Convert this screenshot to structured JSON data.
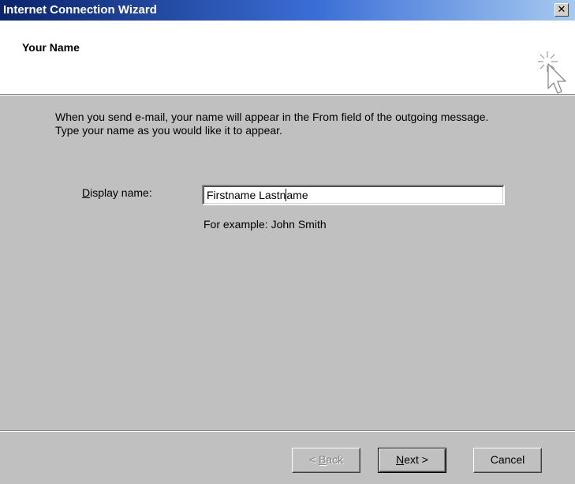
{
  "window": {
    "title": "Internet Connection Wizard",
    "close_icon": "close-x-icon",
    "close_glyph": "✕"
  },
  "header": {
    "page_title": "Your Name",
    "icon": "wizard-cursor-icon"
  },
  "intro": {
    "line1": "When you send e-mail, your name will appear in the From field of the outgoing message.",
    "line2": "Type your name as you would like it to appear."
  },
  "display_name": {
    "label_hotkey": "D",
    "label_rest": "isplay name:",
    "value_before_caret": "Firstname Lastn",
    "value_after_caret": "ame",
    "example": "For example: John Smith"
  },
  "buttons": {
    "back_prefix": "< ",
    "back_hotkey": "B",
    "back_rest": "ack",
    "back_enabled": false,
    "next_hotkey": "N",
    "next_rest": "ext >",
    "cancel": "Cancel"
  },
  "colors": {
    "titlebar_start": "#0a246a",
    "titlebar_end": "#a6caf0",
    "dialog_bg": "#c0c0c0",
    "header_bg": "#ffffff"
  }
}
